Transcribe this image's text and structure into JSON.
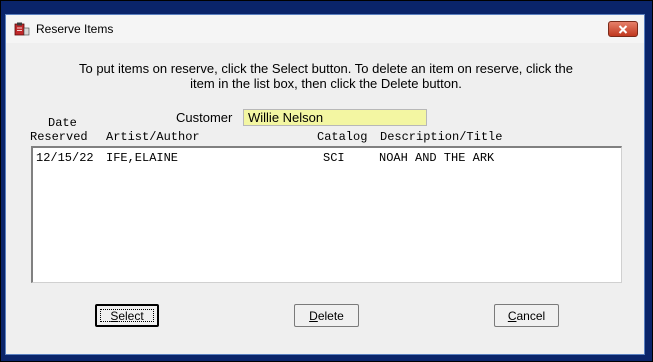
{
  "window": {
    "title": "Reserve Items"
  },
  "instructions": {
    "line1": "To put items on reserve, click the Select button.  To delete an item on reserve, click the",
    "line2": "item in the list box, then click the Delete button."
  },
  "customer": {
    "label": "Customer",
    "value": "Willie Nelson"
  },
  "columns": {
    "date_top": "Date",
    "date_bottom": "Reserved",
    "artist": "Artist/Author",
    "catalog": "Catalog",
    "description": "Description/Title"
  },
  "reserve_list": [
    {
      "date": "12/15/22",
      "artist": "IFE,ELAINE",
      "catalog": "SCI",
      "description": "NOAH AND THE ARK"
    }
  ],
  "buttons": {
    "select": {
      "accel": "S",
      "rest": "elect"
    },
    "delete": {
      "accel": "D",
      "rest": "elete"
    },
    "cancel": {
      "accel": "C",
      "rest": "ancel"
    }
  },
  "colors": {
    "frame": "#0a246a",
    "customer_field_bg": "#f3f6a2",
    "close_button": "#c0381f"
  }
}
